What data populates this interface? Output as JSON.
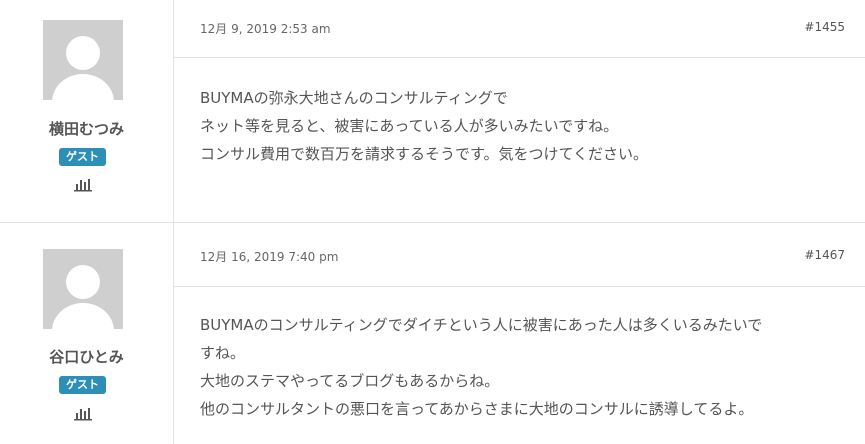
{
  "posts": [
    {
      "author": "横田むつみ",
      "badge": "ゲスト",
      "date": "12月 9, 2019 2:53 am",
      "number": "#1455",
      "lines": [
        "BUYMAの弥永大地さんのコンサルティングで",
        "ネット等を見ると、被害にあっている人が多いみたいですね。",
        "コンサル費用で数百万を請求するそうです。気をつけてください。"
      ]
    },
    {
      "author": "谷口ひとみ",
      "badge": "ゲスト",
      "date": "12月 16, 2019 7:40 pm",
      "number": "#1467",
      "lines": [
        "BUYMAのコンサルティングでダイチという人に被害にあった人は多くいるみたいで",
        "すね。",
        "大地のステマやってるブログもあるからね。",
        "他のコンサルタントの悪口を言ってあからさまに大地のコンサルに誘導してるよ。"
      ]
    }
  ],
  "icons": {
    "avatar": "default-avatar-icon",
    "stats": "bar-chart-icon"
  },
  "colors": {
    "badge": "#2d8fb8",
    "border": "#e3e3e3",
    "text": "#555555",
    "avatar_bg": "#cfcfcf"
  }
}
